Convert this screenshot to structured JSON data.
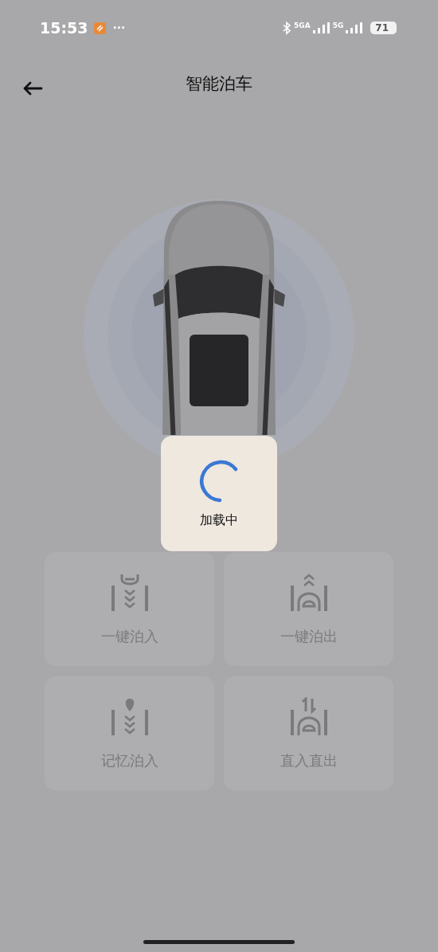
{
  "status_bar": {
    "time": "15:53",
    "more": "···",
    "network_1": "5GA",
    "network_2": "5G",
    "battery": "71"
  },
  "header": {
    "title": "智能泊车"
  },
  "loading": {
    "text": "加载中"
  },
  "actions": [
    {
      "kind": "park-in",
      "label": "一键泊入",
      "disabled": true
    },
    {
      "kind": "park-out",
      "label": "一键泊出",
      "disabled": true
    },
    {
      "kind": "memory-park-in",
      "label": "记忆泊入",
      "disabled": true
    },
    {
      "kind": "straight-in-out",
      "label": "直入直出",
      "disabled": true
    }
  ]
}
